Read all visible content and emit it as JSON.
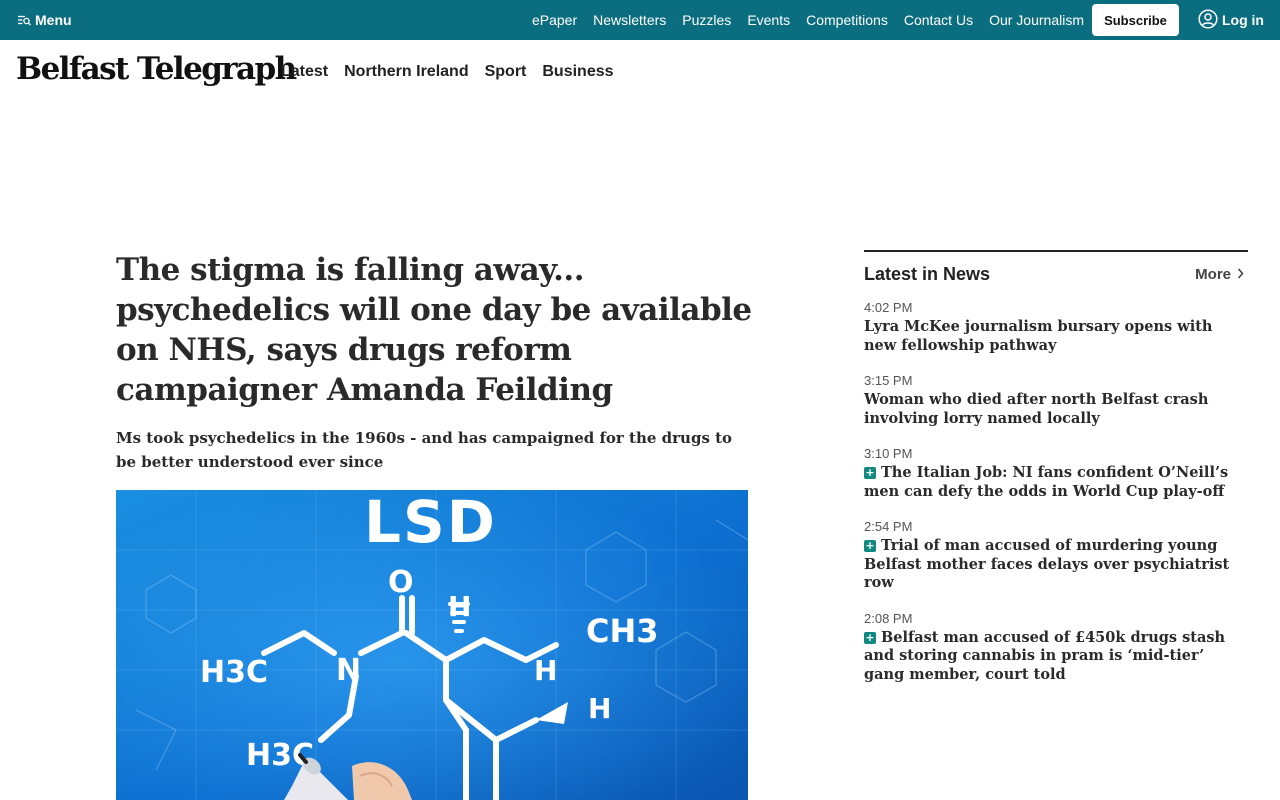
{
  "topbar": {
    "menu_label": "Menu",
    "links": [
      "ePaper",
      "Newsletters",
      "Puzzles",
      "Events",
      "Competitions",
      "Contact Us",
      "Our Journalism"
    ],
    "subscribe_label": "Subscribe",
    "login_label": "Log in",
    "bg_color": "#0b6e80"
  },
  "brand": {
    "logo_text": "Belfast Telegraph",
    "nav": [
      "Latest",
      "Northern Ireland",
      "Sport",
      "Business"
    ]
  },
  "article": {
    "headline": "The stigma is falling away... psychedelics will one day be available on NHS, says drugs reform campaigner Amanda Feilding",
    "standfirst": "Ms took psychedelics in the 1960s - and has campaigned for the drugs to be better understood ever since",
    "image": {
      "heading": "LSD",
      "labels": [
        "O",
        "H",
        "CH3",
        "H3C",
        "N",
        "H",
        "H",
        "H3C"
      ]
    }
  },
  "sidebar": {
    "title": "Latest in News",
    "more_label": "More",
    "items": [
      {
        "time": "4:02 PM",
        "title": "Lyra McKee journalism bursary opens with new fellowship pathway",
        "premium": false
      },
      {
        "time": "3:15 PM",
        "title": "Woman who died after north Belfast crash involving lorry named locally",
        "premium": false
      },
      {
        "time": "3:10 PM",
        "title": "The Italian Job: NI fans confident O’Neill’s men can defy the odds in World Cup play-off",
        "premium": true
      },
      {
        "time": "2:54 PM",
        "title": "Trial of man accused of murdering young Belfast mother faces delays over psychiatrist row",
        "premium": true
      },
      {
        "time": "2:08 PM",
        "title": "Belfast man accused of £450k drugs stash and storing cannabis in pram is ‘mid-tier’ gang member, court told",
        "premium": true
      }
    ]
  }
}
